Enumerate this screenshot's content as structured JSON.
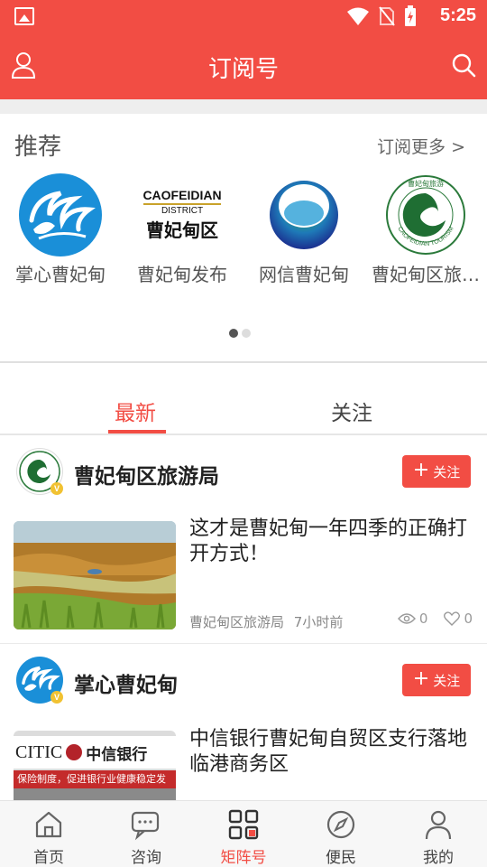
{
  "status_bar": {
    "time": "5:25"
  },
  "app_bar": {
    "title": "订阅号"
  },
  "recommend": {
    "title": "推荐",
    "more": "订阅更多 >",
    "items": [
      {
        "name": "掌心曹妃甸"
      },
      {
        "name": "曹妃甸发布",
        "logo_text_en": "CAOFEIDIAN",
        "logo_text_district": "DISTRICT",
        "logo_text_cn": "曹妃甸区"
      },
      {
        "name": "网信曹妃甸"
      },
      {
        "name": "曹妃甸区旅…",
        "logo_ring_text": "CAOFEIDIAN TOURISM",
        "logo_top_text": "曹妃甸旅游"
      }
    ],
    "page_count": 2,
    "active_page": 1
  },
  "tabs": [
    {
      "label": "最新",
      "active": true
    },
    {
      "label": "关注",
      "active": false
    }
  ],
  "feed": [
    {
      "account": "曹妃甸区旅游局",
      "follow_label": "关注",
      "article": {
        "title": "这才是曹妃甸一年四季的正确打开方式！",
        "source": "曹妃甸区旅游局",
        "time": "7小时前",
        "views": "0",
        "likes": "0"
      }
    },
    {
      "account": "掌心曹妃甸",
      "follow_label": "关注",
      "article": {
        "title": "中信银行曹妃甸自贸区支行落地临港商务区",
        "thumb_sign_en": "CITIC",
        "thumb_sign_cn": "中信银行",
        "thumb_banner": "保险制度，促进银行业健康稳定发"
      }
    }
  ],
  "bottom_nav": [
    {
      "label": "首页",
      "icon": "home-icon",
      "active": false
    },
    {
      "label": "咨询",
      "icon": "chat-icon",
      "active": false
    },
    {
      "label": "矩阵号",
      "icon": "grid-icon",
      "active": true
    },
    {
      "label": "便民",
      "icon": "compass-icon",
      "active": false
    },
    {
      "label": "我的",
      "icon": "person-icon",
      "active": false
    }
  ],
  "colors": {
    "accent": "#f24d44",
    "badge": "#f1c232",
    "wave_blue": "#1a8fd8"
  }
}
